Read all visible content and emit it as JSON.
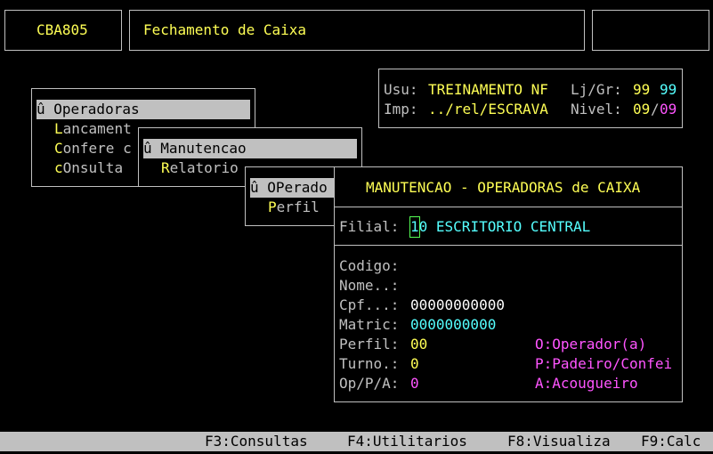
{
  "header": {
    "program_code": "CBA805",
    "screen_title": "Fechamento de Caixa",
    "right_box": ""
  },
  "user_info": {
    "usu_label": "Usu:",
    "usu_value": "TREINAMENTO NF",
    "ljgr_label": "Lj/Gr:",
    "lj_value": "99",
    "gr_value": "99",
    "imp_label": "Imp:",
    "imp_value": "../rel/ESCRAVA",
    "nivel_label": "Nivel:",
    "nivel_value_a": "09",
    "nivel_sep": "/",
    "nivel_value_b": "09"
  },
  "menu1": {
    "title": "û Operadoras",
    "items": [
      {
        "hot": "L",
        "rest": "ancament"
      },
      {
        "hot": "C",
        "rest": "onfere c"
      },
      {
        "hot": "c",
        "rest": "Onsulta"
      }
    ]
  },
  "menu2": {
    "title": "û Manutencao",
    "items": [
      {
        "hot": "R",
        "rest": "elatorio"
      }
    ]
  },
  "menu3": {
    "title": "û OPerado",
    "items": [
      {
        "hot": "P",
        "rest": "erfil"
      }
    ]
  },
  "form": {
    "title": "MANUTENCAO - OPERADORAS de CAIXA",
    "filial_label": "Filial:",
    "filial_cursor": "1",
    "filial_value": "0 ESCRITORIO CENTRAL",
    "fields": {
      "codigo_label": "Codigo:",
      "nome_label": "Nome..:",
      "cpf_label": "Cpf...:",
      "cpf_value": "00000000000",
      "matric_label": "Matric:",
      "matric_value": "0000000000",
      "perfil_label": "Perfil:",
      "perfil_value": "00",
      "turno_label": "Turno.:",
      "turno_value": "0",
      "opa_label": "Op/P/A:",
      "opa_value": "0"
    },
    "legend": {
      "o": "O:Operador(a)",
      "p": "P:Padeiro/Confei",
      "a": "A:Acougueiro"
    }
  },
  "function_keys": [
    "F3:Consultas",
    "F4:Utilitarios",
    "F8:Visualiza",
    "F9:Calc"
  ],
  "colors": {
    "background": "#000000",
    "frame": "#c0c0c0",
    "yellow": "#ffff55",
    "cyan": "#55ffff",
    "magenta": "#ff55ff",
    "status_bar": "#c0c0c0"
  }
}
